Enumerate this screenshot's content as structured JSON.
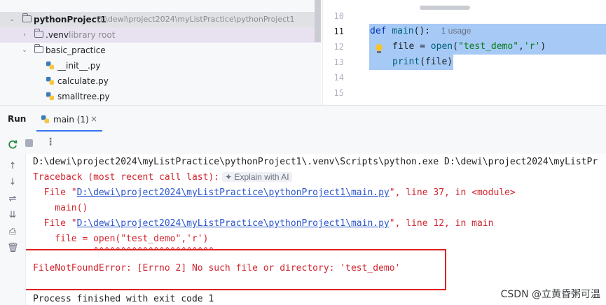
{
  "project_tree": {
    "root_name": "pythonProject1",
    "root_path": "D:\\dewi\\project2024\\myListPractice\\pythonProject1",
    "items": [
      {
        "name": ".venv",
        "note": "library root"
      },
      {
        "name": "basic_practice"
      },
      {
        "name": "__init__.py"
      },
      {
        "name": "calculate.py"
      },
      {
        "name": "smalltree.py"
      }
    ]
  },
  "editor": {
    "line_numbers": [
      "10",
      "11",
      "12",
      "13",
      "14",
      "15"
    ],
    "line11": {
      "kw": "def",
      "fn": "main",
      "rest": "():",
      "usage_hint": "1 usage"
    },
    "line12": {
      "pre": "file = ",
      "fn": "open",
      "open_paren": "(",
      "arg1": "\"test_demo\"",
      "comma": ",",
      "arg2": "'r'",
      "close_paren": ")"
    },
    "line13": {
      "fn": "print",
      "rest": "(file)"
    }
  },
  "run_window": {
    "title": "Run",
    "tab_label": "main (1)",
    "tab_close": "×"
  },
  "console": {
    "line1": "D:\\dewi\\project2024\\myListPractice\\pythonProject1\\.venv\\Scripts\\python.exe D:\\dewi\\project2024\\myListPr",
    "line2": "Traceback (most recent call last):",
    "explain_ai": "Explain with AI",
    "line3_pre": "  File \"",
    "line3_link": "D:\\dewi\\project2024\\myListPractice\\pythonProject1\\main.py",
    "line3_post": "\", line 37, in <module>",
    "line4": "    main()",
    "line5_pre": "  File \"",
    "line5_link": "D:\\dewi\\project2024\\myListPractice\\pythonProject1\\main.py",
    "line5_post": "\", line 12, in main",
    "line6": "    file = open(\"test_demo\",'r')",
    "line7": "           ^^^^^^^^^^^^^^^^^^^^^^",
    "line8": "FileNotFoundError: [Errno 2] No such file or directory: 'test_demo'",
    "line9": "Process finished with exit code 1"
  },
  "watermark": "CSDN @立黄昏粥可温",
  "colors": {
    "error_red": "#d1242f",
    "link_blue": "#2a55cc",
    "selection": "#a6c9f6",
    "highlight_box": "#e02020"
  }
}
